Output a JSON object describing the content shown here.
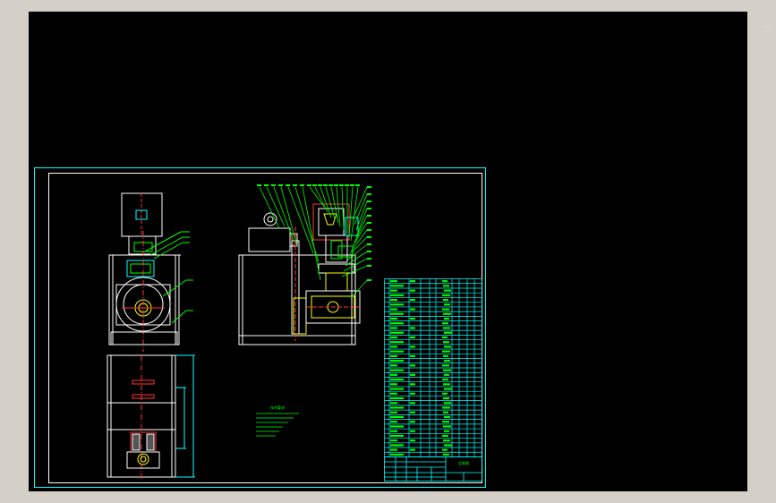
{
  "app": {
    "title": ""
  },
  "drawing": {
    "notes_title": "技术要求",
    "title_block_name": "总装图",
    "colors": {
      "background": "#000000",
      "frame": "#00ffff",
      "geometry": "#ffffff",
      "annotation": "#00ff00",
      "centerline": "#ff0000",
      "hatch": "#ff3333",
      "highlight": "#ffff00",
      "dimension": "#00ffff"
    },
    "icons": [
      "cad-viewport",
      "drawing-sheet"
    ]
  }
}
